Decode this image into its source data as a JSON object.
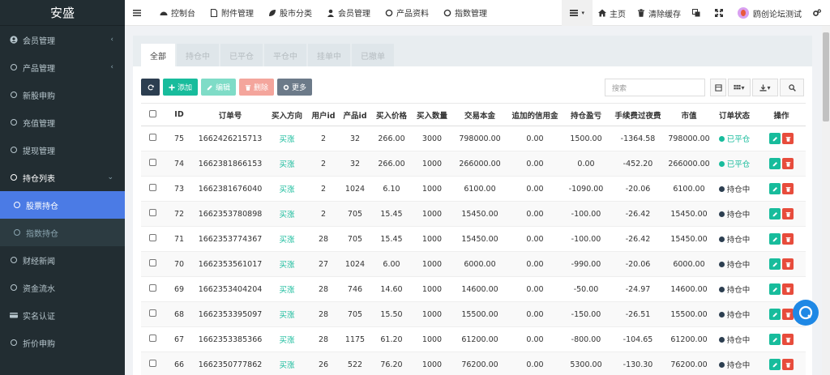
{
  "brand": "安盛",
  "sidebar": {
    "items": [
      {
        "label": "会员管理",
        "icon": "user-circle-icon",
        "caret": "‹"
      },
      {
        "label": "产品管理",
        "icon": "circle-icon",
        "caret": "‹"
      },
      {
        "label": "新股申购",
        "icon": "circle-icon"
      },
      {
        "label": "充值管理",
        "icon": "circle-icon"
      },
      {
        "label": "提现管理",
        "icon": "circle-icon"
      },
      {
        "label": "持仓列表",
        "icon": "circle-icon",
        "caret": "⌄"
      },
      {
        "label": "股票持仓",
        "icon": "circle-icon"
      },
      {
        "label": "指数持仓",
        "icon": "circle-icon"
      },
      {
        "label": "财经新闻",
        "icon": "circle-icon"
      },
      {
        "label": "资金流水",
        "icon": "circle-icon"
      },
      {
        "label": "实名认证",
        "icon": "id-card-icon"
      },
      {
        "label": "折价申购",
        "icon": "circle-icon"
      }
    ]
  },
  "topbar": {
    "nav": [
      {
        "label": "控制台",
        "icon": "dashboard-icon"
      },
      {
        "label": "附件管理",
        "icon": "file-icon"
      },
      {
        "label": "股市分类",
        "icon": "leaf-icon"
      },
      {
        "label": "会员管理",
        "icon": "user-icon"
      },
      {
        "label": "产品资料",
        "icon": "circle-icon"
      },
      {
        "label": "指数管理",
        "icon": "circle-icon"
      }
    ],
    "home": "主页",
    "clear_cache": "清除缓存",
    "user": "鸥创论坛测试"
  },
  "tabs": [
    "全部",
    "持仓中",
    "已平仓",
    "平仓中",
    "挂单中",
    "已撤单"
  ],
  "toolbar": {
    "add": "添加",
    "edit": "编辑",
    "delete": "删除",
    "more": "更多"
  },
  "search": {
    "placeholder": "搜索"
  },
  "table": {
    "headers": [
      "ID",
      "订单号",
      "买入方向",
      "用户id",
      "产品id",
      "买入价格",
      "买入数量",
      "交易本金",
      "追加的信用金",
      "持仓盈亏",
      "手续费过夜费",
      "市值",
      "订单状态",
      "操作"
    ],
    "rows": [
      [
        "75",
        "1662426215713",
        "买涨",
        "2",
        "32",
        "266.00",
        "3000",
        "798000.00",
        "0.00",
        "1500.00",
        "-1364.58",
        "798000.00",
        "已平仓"
      ],
      [
        "74",
        "1662381866153",
        "买涨",
        "2",
        "32",
        "266.00",
        "1000",
        "266000.00",
        "0.00",
        "0.00",
        "-452.20",
        "266000.00",
        "已平仓"
      ],
      [
        "73",
        "1662381676040",
        "买涨",
        "2",
        "1024",
        "6.10",
        "1000",
        "6100.00",
        "0.00",
        "-1090.00",
        "-20.06",
        "6100.00",
        "持仓中"
      ],
      [
        "72",
        "1662353780898",
        "买涨",
        "2",
        "705",
        "15.45",
        "1000",
        "15450.00",
        "0.00",
        "-100.00",
        "-26.42",
        "15450.00",
        "持仓中"
      ],
      [
        "71",
        "1662353774367",
        "买涨",
        "28",
        "705",
        "15.45",
        "1000",
        "15450.00",
        "0.00",
        "-100.00",
        "-26.42",
        "15450.00",
        "持仓中"
      ],
      [
        "70",
        "1662353561017",
        "买涨",
        "27",
        "1024",
        "6.00",
        "1000",
        "6000.00",
        "0.00",
        "-990.00",
        "-20.06",
        "6000.00",
        "持仓中"
      ],
      [
        "69",
        "1662353404204",
        "买涨",
        "28",
        "746",
        "14.60",
        "1000",
        "14600.00",
        "0.00",
        "-50.00",
        "-24.97",
        "14600.00",
        "持仓中"
      ],
      [
        "68",
        "1662353395097",
        "买涨",
        "28",
        "705",
        "15.50",
        "1000",
        "15500.00",
        "0.00",
        "-150.00",
        "-26.51",
        "15500.00",
        "持仓中"
      ],
      [
        "67",
        "1662353385366",
        "买涨",
        "28",
        "1175",
        "61.20",
        "1000",
        "61200.00",
        "0.00",
        "-800.00",
        "-104.65",
        "61200.00",
        "持仓中"
      ],
      [
        "66",
        "1662350777862",
        "买涨",
        "26",
        "522",
        "76.20",
        "1000",
        "76200.00",
        "0.00",
        "5300.00",
        "-130.30",
        "76200.00",
        "持仓中"
      ]
    ]
  },
  "colors": {
    "sidebar_bg": "#222d32",
    "active_bg": "#4b7be5",
    "success": "#18bc9c",
    "danger": "#e74c3c",
    "dark": "#2c3e50"
  }
}
